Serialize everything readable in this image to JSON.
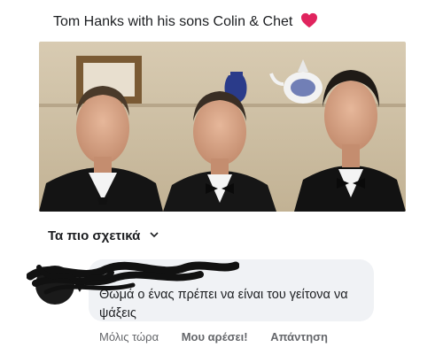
{
  "post": {
    "title": "Tom Hanks with his sons Colin & Chet",
    "title_emoji_icon": "red-heart-icon",
    "accent_color": "#e0245e"
  },
  "comments_section": {
    "sort_label": "Τα πιο σχετικά",
    "sort_icon": "chevron-down-icon"
  },
  "comment": {
    "text": "Θωμά ο ένας πρέπει να είναι του γείτονα να ψάξεις",
    "timestamp": "Μόλις τώρα",
    "like_label": "Μου αρέσει!",
    "reply_label": "Απάντηση"
  }
}
